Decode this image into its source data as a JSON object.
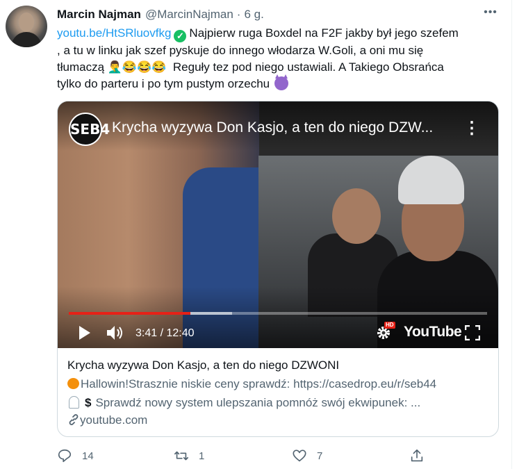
{
  "tweet": {
    "author_name": "Marcin Najman",
    "author_handle": "@MarcinNajman",
    "separator": "·",
    "time": "6 g.",
    "text": {
      "link": "youtu.be/HtSRluovfkg",
      "line1_rest": "Najpierw ruga Boxdel na F2F jakby był jego szefem",
      "line2": ", a tu w linku jak szef pyskuje do innego włodarza W.Goli, a oni mu się",
      "line3_a": "tłumaczą",
      "line3_emojis": "🤦‍♂️😂😂😂",
      "line3_b": "Reguły tez pod niego ustawiali. A Takiego Obsrańca",
      "line4": "tylko do parteru i po tym pustym orzechu"
    }
  },
  "video": {
    "channel_logo": "SEB4",
    "title": "Krycha wyzywa Don Kasjo, a ten do niego DZW...",
    "current_time": "3:41",
    "duration": "12:40",
    "time_display": "3:41 / 12:40",
    "progress_fraction": 0.291,
    "buffer_fraction": 0.39,
    "hd_badge": "HD",
    "platform_logo": "YouTube",
    "progress_color": "#e62117"
  },
  "card": {
    "title": "Krycha wyzywa Don Kasjo, a ten do niego DZWONI",
    "desc_line1": "Hallowin!Strasznie niskie ceny sprawdź: https://casedrop.eu/r/seb44",
    "desc_line2_symbol": "$",
    "desc_line2": "Sprawdź nowy system ulepszania pomnóż swój ekwipunek: ...",
    "domain": "youtube.com"
  },
  "actions": {
    "reply_count": "14",
    "retweet_count": "1",
    "like_count": "7"
  },
  "colors": {
    "link": "#1d9bf0",
    "secondary_text": "#536471",
    "verified": "#17bf63"
  }
}
